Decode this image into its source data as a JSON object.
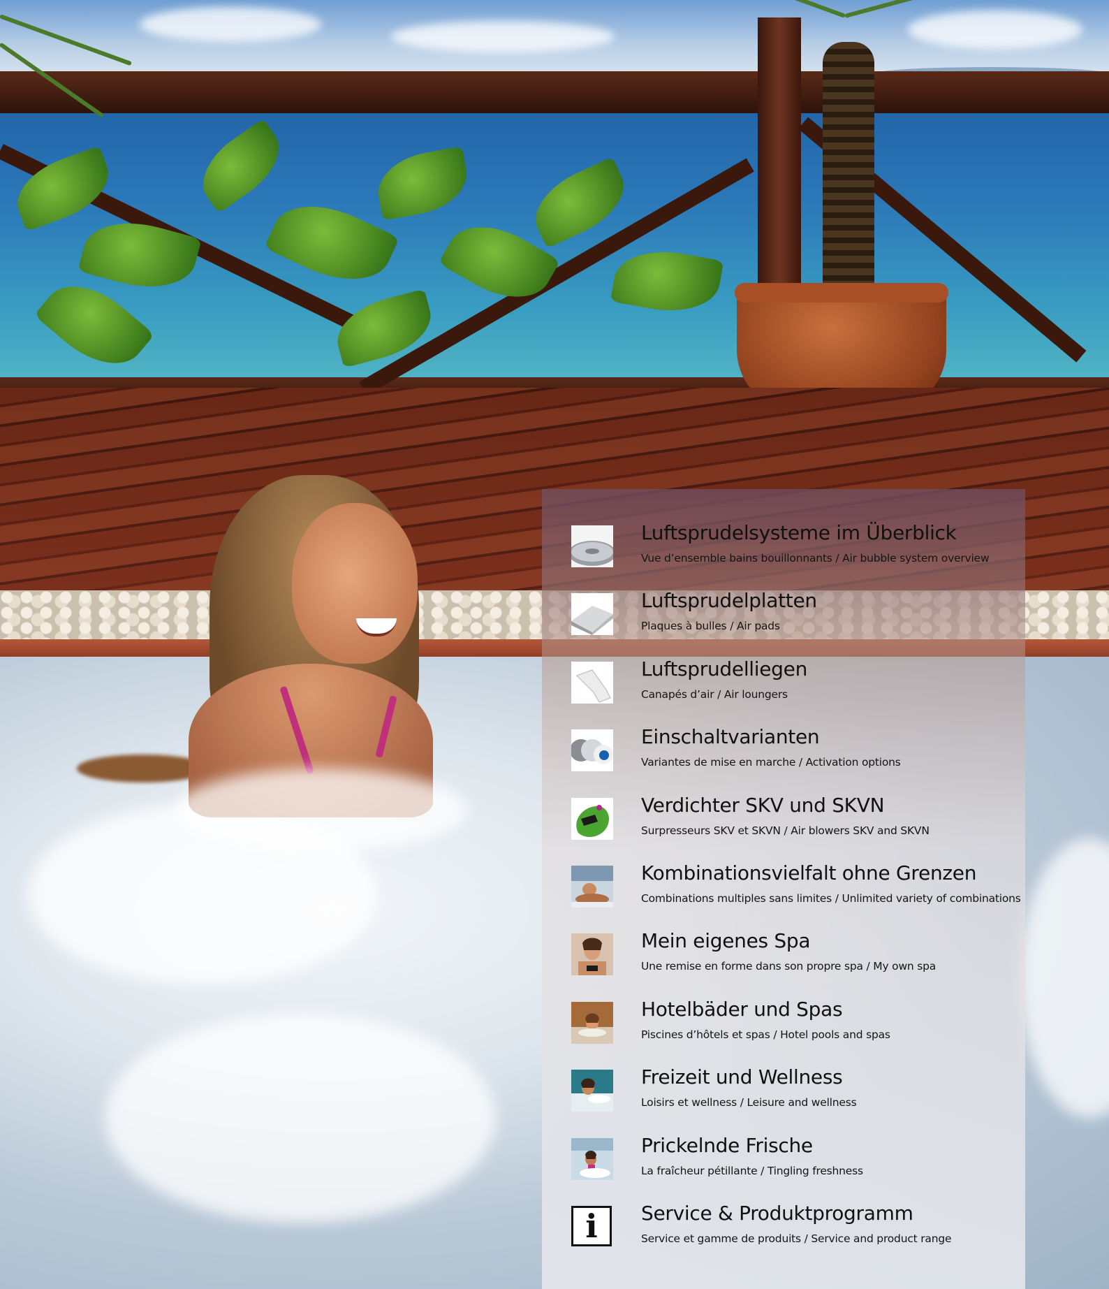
{
  "menu": {
    "items": [
      {
        "title": "Luftsprudelsysteme im Überblick",
        "subtitle": "Vue d’ensemble bains bouillonnants / Air bubble system overview",
        "icon": "disc-icon"
      },
      {
        "title": "Luftsprudelplatten",
        "subtitle": "Plaques à bulles / Air pads",
        "icon": "pad-icon"
      },
      {
        "title": "Luftsprudelliegen",
        "subtitle": "Canapés d’air / Air loungers",
        "icon": "lounger-icon"
      },
      {
        "title": "Einschaltvarianten",
        "subtitle": "Variantes de mise en marche / Activation options",
        "icon": "switch-icon"
      },
      {
        "title": "Verdichter SKV und SKVN",
        "subtitle": "Surpresseurs SKV et SKVN / Air blowers SKV and SKVN",
        "icon": "blower-icon"
      },
      {
        "title": "Kombinationsvielfalt ohne Grenzen",
        "subtitle": "Combinations multiples sans limites / Unlimited variety of combinations",
        "icon": "combination-photo-icon"
      },
      {
        "title": "Mein eigenes Spa",
        "subtitle": "Une remise en forme dans son propre spa / My own spa",
        "icon": "spa-photo-icon"
      },
      {
        "title": "Hotelbäder und Spas",
        "subtitle": "Piscines d’hôtels et spas / Hotel pools and spas",
        "icon": "hotel-photo-icon"
      },
      {
        "title": "Freizeit und Wellness",
        "subtitle": "Loisirs et wellness / Leisure and wellness",
        "icon": "leisure-photo-icon"
      },
      {
        "title": "Prickelnde Frische",
        "subtitle": "La fraîcheur pétillante / Tingling freshness",
        "icon": "freshness-photo-icon"
      },
      {
        "title": "Service & Produktprogramm",
        "subtitle": "Service et gamme de produits / Service and product range",
        "icon": "info-icon",
        "icon_glyph": "i"
      }
    ]
  }
}
